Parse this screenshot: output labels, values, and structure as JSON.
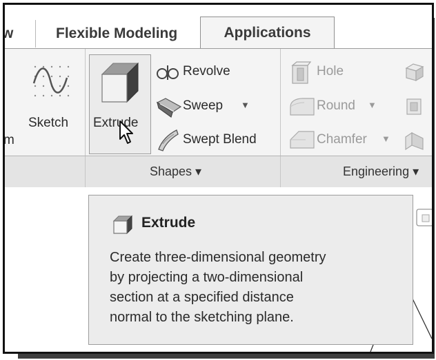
{
  "tabs": {
    "partial_left": "w",
    "flexible_modeling": "Flexible Modeling",
    "applications": "Applications"
  },
  "ribbon": {
    "partial_left_label": "m",
    "sketch_label": "Sketch",
    "extrude_label": "Extrude",
    "revolve_label": "Revolve",
    "sweep_label": "Sweep",
    "sweep_arrow": "▼",
    "swept_blend_label": "Swept Blend",
    "hole_label": "Hole",
    "round_label": "Round",
    "round_arrow": "▼",
    "chamfer_label": "Chamfer",
    "chamfer_arrow": "▼",
    "groups": {
      "shapes": "Shapes ▾",
      "engineering": "Engineering ▾"
    }
  },
  "tooltip": {
    "title": "Extrude",
    "lines": [
      "Create three-dimensional geometry",
      "by projecting a two-dimensional",
      "section at a specified distance",
      "normal to the sketching plane."
    ]
  },
  "colors": {
    "ribbon_bg": "#f4f4f4",
    "group_bar_bg": "#e4e4e4",
    "tooltip_bg": "#ececec",
    "disabled_text": "#9a9a9a",
    "frame_border": "#111111"
  }
}
